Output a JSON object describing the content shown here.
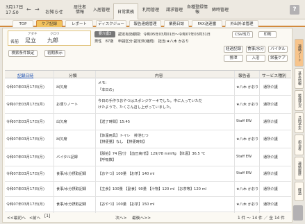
{
  "header": {
    "date": "3月17日",
    "time": "17:50",
    "prev": "←",
    "next": "→",
    "notice": "お知らせ",
    "menus": [
      "居住者情報",
      "入居管理",
      "日常業務",
      "利用管理",
      "請求管理",
      "各種登録情報",
      "締時管理"
    ],
    "help": "?"
  },
  "tabs": [
    "TOP",
    "ケア記録",
    "レポート",
    "ディスクジュール",
    "報告連絡管理",
    "業務日誌",
    "FAX送連番",
    "外出外泊管理"
  ],
  "patient": {
    "furigana_last": "アダチ",
    "furigana_first": "クロウ",
    "name_label": "名前",
    "last_name": "足立",
    "first_name": "九郎",
    "badge": "要介護3",
    "cert_period": "認定有効期間：令和05年03月01日〜令和07年03月31日",
    "gender_age": "男性　87歳　",
    "plan": "申請区分:認定済(継続)　担当:★八木 かおり"
  },
  "buttons": {
    "csv": "CSV出力",
    "print": "印刷",
    "search_cond": "検索条件設定",
    "reset": "初期表示",
    "cond_output": "経過記録",
    "meal_water": "食事/水分",
    "vital": "バイタル",
    "excretion": "排泄",
    "bath": "入浴",
    "nutrition": "栄養ケア"
  },
  "table": {
    "headers": [
      "記録日時",
      "分類",
      "内容",
      "報告者",
      "サービス種別"
    ],
    "rows": [
      {
        "datetime": "令和07年03月17日(月)",
        "category": "出欠席",
        "content1": "メモ：",
        "content2": "「本日の」",
        "reporter": "★八木 かおり",
        "service": "通所介護"
      },
      {
        "datetime": "令和07年03月17日(月)",
        "category": "お便りノート",
        "content1": "今日の手作りおやつはスポンジケーキでした。中に入っていただ",
        "content2": "けたようで、たくさん召し上がっていました。",
        "reporter": "★八木 かおり",
        "service": "通所介護"
      },
      {
        "datetime": "令和07年03月17日(月)",
        "category": "出欠席",
        "content1": "【送了時間】15:45",
        "content2": "",
        "reporter": "Staff EW",
        "service": "通所介護"
      },
      {
        "datetime": "令和07年03月17日(月)",
        "category": "出欠席",
        "content1": "【体温用具】トイレ　排泄むつ",
        "content2": "【排便量】なし　【排便時刻】",
        "reporter": "★八木 かおり",
        "service": "通所介護"
      },
      {
        "datetime": "令和07年03月17日(月)",
        "category": "バイタル記録",
        "content1": "【脈拍】74 回/分 【血圧高/低】129/78 mmHg 【体温】36.5 ℃",
        "content2": "【呼吸数】",
        "reporter": "Staff EW",
        "service": "通所介護"
      },
      {
        "datetime": "令和07年03月17日(月)",
        "category": "食事/水分摂取記録",
        "content1": "【おやつ】100量 【お茶】140 ml",
        "content2": "",
        "reporter": "Staff EW",
        "service": "通所介護"
      },
      {
        "datetime": "令和07年03月17日(月)",
        "category": "食事/水分摂取記録",
        "content1": "【主食】100量 【副食】90量 【汁物】120 ml 【お茶等】120 ml",
        "content2": "",
        "reporter": "★八木 かおり",
        "service": "通所介護"
      },
      {
        "datetime": "令和07年03月17日(月)",
        "category": "食事/水分摂取記録",
        "content1": "【おやつ】100量 【お茶】150 ml",
        "content2": "",
        "reporter": "★八木 かおり",
        "service": "通所介護"
      }
    ]
  },
  "footer": {
    "first": "<<最初へ",
    "prev": "<前へ",
    "page": "[1]",
    "next": "次へ>",
    "last": "最後へ>>",
    "count": "1 件 〜 14 件 ／ 全 14 件"
  },
  "sidetabs": [
    "連絡ノート",
    "基本情報",
    "援護状況",
    "月間予定",
    "担当者",
    "連絡履歴",
    "経過"
  ]
}
